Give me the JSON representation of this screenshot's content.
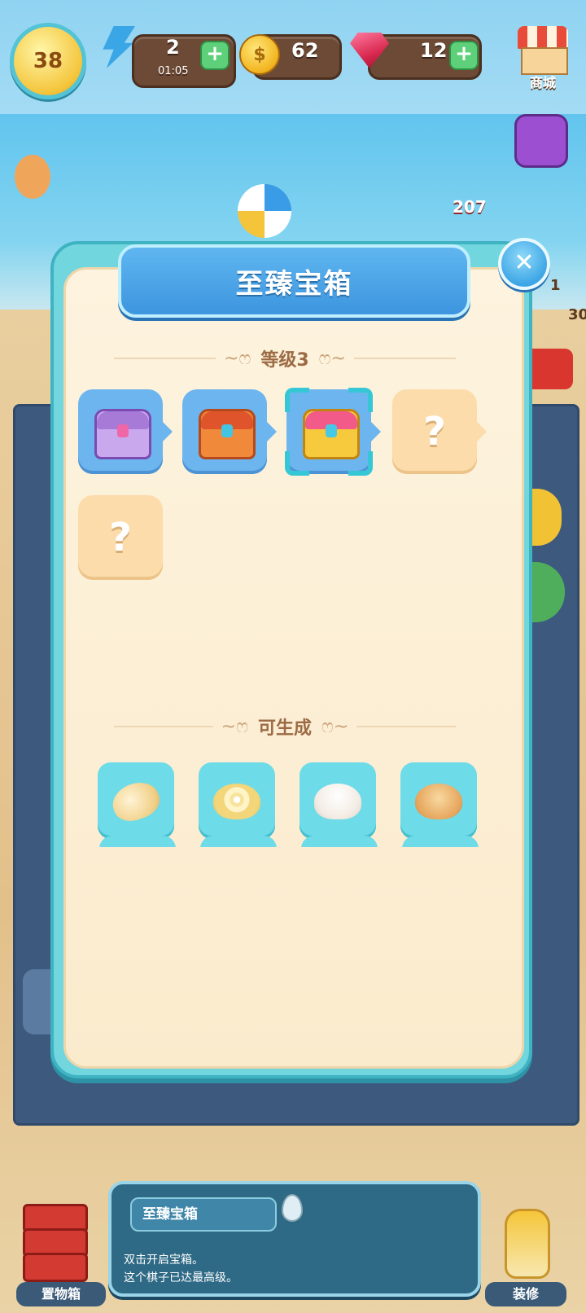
{
  "hud": {
    "level": "38",
    "energy": {
      "value": "2",
      "timer": "01:05"
    },
    "coins": "62",
    "gems": "12",
    "shop_label": "商城",
    "bubble_count": "207",
    "side_value_1": "1",
    "side_value_2": "30"
  },
  "modal": {
    "title": "至臻宝箱",
    "level_heading": "等级3",
    "chain": [
      {
        "state": "unlocked",
        "icon": "purple-chest-icon"
      },
      {
        "state": "unlocked",
        "icon": "red-chest-icon"
      },
      {
        "state": "selected",
        "icon": "golden-treasure-chest-icon"
      },
      {
        "state": "locked",
        "icon": "question-mark-icon",
        "label": "?"
      },
      {
        "state": "locked",
        "icon": "question-mark-icon",
        "label": "?"
      }
    ],
    "generates_heading": "可生成",
    "generates": [
      {
        "icon": "bread-roll-icon"
      },
      {
        "icon": "swirl-bun-icon"
      },
      {
        "icon": "steamed-bun-icon"
      },
      {
        "icon": "sesame-bun-icon"
      }
    ]
  },
  "bottom": {
    "item_title": "至臻宝箱",
    "description_line1": "双击开启宝箱。",
    "description_line2": "这个棋子已达最高级。",
    "storage_label": "置物箱",
    "decorate_label": "装修"
  },
  "colors": {
    "modal_frame": "#71d6de",
    "title_banner": "#3d95df",
    "parchment": "#fdf3de",
    "heading_text": "#9c6b45",
    "generate_tile": "#6ddbe8"
  }
}
